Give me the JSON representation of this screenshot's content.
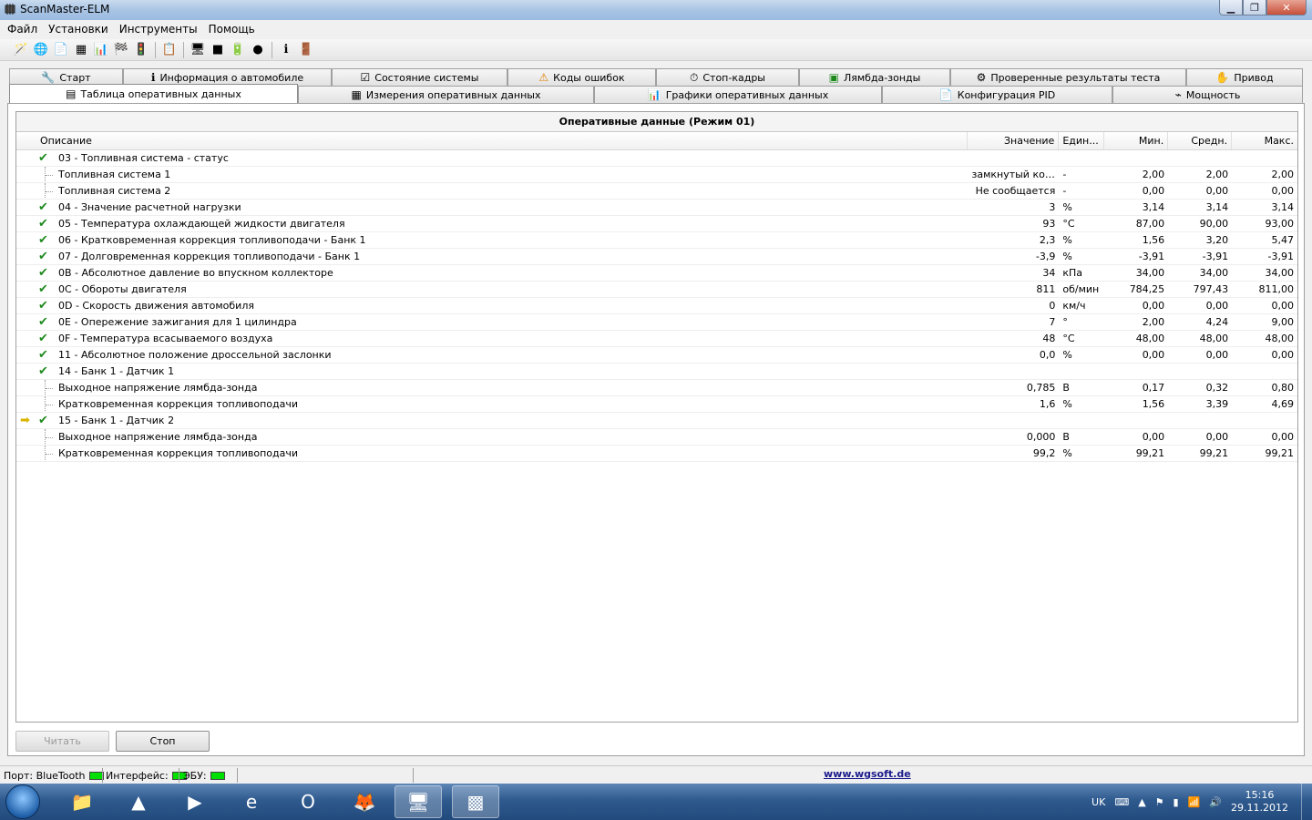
{
  "window": {
    "title": "ScanMaster-ELM"
  },
  "menu": [
    "Файл",
    "Установки",
    "Инструменты",
    "Помощь"
  ],
  "toolbar_icons": [
    "wizard-icon",
    "globe-icon",
    "document-icon",
    "table-icon",
    "chart-icon",
    "flags-icon",
    "traffic-light-icon",
    "clipboard-icon",
    "monitor-icon",
    "terminal-icon",
    "battery-icon",
    "disc-icon",
    "info-icon",
    "exit-icon"
  ],
  "tabs_row1": [
    {
      "label": "Старт",
      "icon": "start-icon"
    },
    {
      "label": "Информация о автомобиле",
      "icon": "info-icon"
    },
    {
      "label": "Состояние системы",
      "icon": "status-icon"
    },
    {
      "label": "Коды ошибок",
      "icon": "warning-icon"
    },
    {
      "label": "Стоп-кадры",
      "icon": "freeze-frame-icon"
    },
    {
      "label": "Лямбда-зонды",
      "icon": "lambda-icon"
    },
    {
      "label": "Проверенные результаты теста",
      "icon": "gear-icon"
    },
    {
      "label": "Привод",
      "icon": "actuator-icon"
    }
  ],
  "tabs_row2": [
    {
      "label": "Таблица оперативных данных",
      "icon": "list-icon"
    },
    {
      "label": "Измерения оперативных данных",
      "icon": "gauges-icon"
    },
    {
      "label": "Графики оперативных данных",
      "icon": "chart-icon"
    },
    {
      "label": "Конфигурация PID",
      "icon": "config-icon"
    },
    {
      "label": "Мощность",
      "icon": "power-icon"
    }
  ],
  "grid": {
    "title": "Оперативные данные (Режим 01)",
    "columns": {
      "desc": "Описание",
      "val": "Значение",
      "unit": "Един...",
      "min": "Мин.",
      "avg": "Средн.",
      "max": "Макс."
    },
    "rows": [
      {
        "type": "parent",
        "desc": "03 - Топливная система - статус",
        "val": "",
        "unit": "",
        "min": "",
        "avg": "",
        "max": ""
      },
      {
        "type": "child",
        "desc": "Топливная система 1",
        "val": "замкнутый кон...",
        "unit": "-",
        "min": "2,00",
        "avg": "2,00",
        "max": "2,00"
      },
      {
        "type": "child",
        "desc": "Топливная система 2",
        "val": "Не сообщается",
        "unit": "-",
        "min": "0,00",
        "avg": "0,00",
        "max": "0,00"
      },
      {
        "type": "parent",
        "desc": "04 - Значение расчетной нагрузки",
        "val": "3",
        "unit": "%",
        "min": "3,14",
        "avg": "3,14",
        "max": "3,14"
      },
      {
        "type": "parent",
        "desc": "05 - Температура охлаждающей жидкости двигателя",
        "val": "93",
        "unit": "°C",
        "min": "87,00",
        "avg": "90,00",
        "max": "93,00"
      },
      {
        "type": "parent",
        "desc": "06 - Кратковременная коррекция топливоподачи - Банк 1",
        "val": "2,3",
        "unit": "%",
        "min": "1,56",
        "avg": "3,20",
        "max": "5,47"
      },
      {
        "type": "parent",
        "desc": "07 - Долговременная коррекция топливоподачи - Банк 1",
        "val": "-3,9",
        "unit": "%",
        "min": "-3,91",
        "avg": "-3,91",
        "max": "-3,91"
      },
      {
        "type": "parent",
        "desc": "0B - Абсолютное давление во впускном коллекторе",
        "val": "34",
        "unit": "кПа",
        "min": "34,00",
        "avg": "34,00",
        "max": "34,00"
      },
      {
        "type": "parent",
        "desc": "0C - Обороты двигателя",
        "val": "811",
        "unit": "об/мин",
        "min": "784,25",
        "avg": "797,43",
        "max": "811,00"
      },
      {
        "type": "parent",
        "desc": "0D - Скорость движения автомобиля",
        "val": "0",
        "unit": "км/ч",
        "min": "0,00",
        "avg": "0,00",
        "max": "0,00"
      },
      {
        "type": "parent",
        "desc": "0E - Опережение зажигания для 1 цилиндра",
        "val": "7",
        "unit": "°",
        "min": "2,00",
        "avg": "4,24",
        "max": "9,00"
      },
      {
        "type": "parent",
        "desc": "0F - Температура всасываемого воздуха",
        "val": "48",
        "unit": "°C",
        "min": "48,00",
        "avg": "48,00",
        "max": "48,00"
      },
      {
        "type": "parent",
        "desc": "11 - Абсолютное положение дроссельной заслонки",
        "val": "0,0",
        "unit": "%",
        "min": "0,00",
        "avg": "0,00",
        "max": "0,00"
      },
      {
        "type": "parent",
        "desc": "14 - Банк 1 - Датчик 1",
        "val": "",
        "unit": "",
        "min": "",
        "avg": "",
        "max": ""
      },
      {
        "type": "child",
        "desc": "Выходное напряжение лямбда-зонда",
        "val": "0,785",
        "unit": "В",
        "min": "0,17",
        "avg": "0,32",
        "max": "0,80"
      },
      {
        "type": "child",
        "desc": "Кратковременная коррекция топливоподачи",
        "val": "1,6",
        "unit": "%",
        "min": "1,56",
        "avg": "3,39",
        "max": "4,69"
      },
      {
        "type": "parent",
        "arrow": true,
        "desc": "15 - Банк 1 - Датчик 2",
        "val": "",
        "unit": "",
        "min": "",
        "avg": "",
        "max": ""
      },
      {
        "type": "child",
        "desc": "Выходное напряжение лямбда-зонда",
        "val": "0,000",
        "unit": "В",
        "min": "0,00",
        "avg": "0,00",
        "max": "0,00"
      },
      {
        "type": "child",
        "desc": "Кратковременная коррекция топливоподачи",
        "val": "99,2",
        "unit": "%",
        "min": "99,21",
        "avg": "99,21",
        "max": "99,21"
      }
    ]
  },
  "buttons": {
    "read": "Читать",
    "stop": "Стоп"
  },
  "status": {
    "port": "Порт: BlueTooth",
    "interface": "Интерфейс:",
    "ecu": "ЭБУ:",
    "link": "www.wgsoft.de",
    "led_color": "#00e000"
  },
  "taskbar": {
    "lang": "UK",
    "time": "15:16",
    "date": "29.11.2012"
  }
}
